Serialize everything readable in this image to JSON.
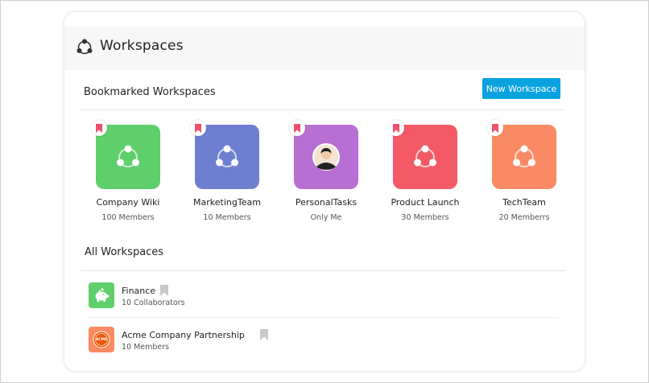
{
  "header": {
    "title": "Workspaces",
    "icon": "workspace-icon"
  },
  "bookmarked": {
    "title": "Bookmarked Workspaces",
    "new_button_label": "New Workspace",
    "items": [
      {
        "name": "Company Wiki",
        "members": "100 Members",
        "color": "#5fcf6b",
        "icon": "workspace-icon"
      },
      {
        "name": "MarketingTeam",
        "members": "10 Members",
        "color": "#6f7fd0",
        "icon": "workspace-icon"
      },
      {
        "name": "PersonalTasks",
        "members": "Only Me",
        "color": "#b86fd3",
        "icon": "avatar-icon"
      },
      {
        "name": "Product Launch",
        "members": "30 Members",
        "color": "#f35a66",
        "icon": "workspace-icon"
      },
      {
        "name": "TechTeam",
        "members": "20 Memberrs",
        "color": "#f98a63",
        "icon": "workspace-icon"
      }
    ]
  },
  "all": {
    "title": "All Workspaces",
    "items": [
      {
        "name": "Finance",
        "sub": "10 Collaborators",
        "color": "#5fcf6b",
        "icon": "piggy-bank-icon"
      },
      {
        "name": "Acme Company Partnership",
        "sub": "10 Members",
        "color": "#f98a63",
        "icon": "acme-logo-icon",
        "logo_text": "ACME"
      }
    ]
  },
  "colors": {
    "accent": "#0aa3e0",
    "bookmark": "#f0506e",
    "bookmark_inactive": "#c8c8c8"
  }
}
